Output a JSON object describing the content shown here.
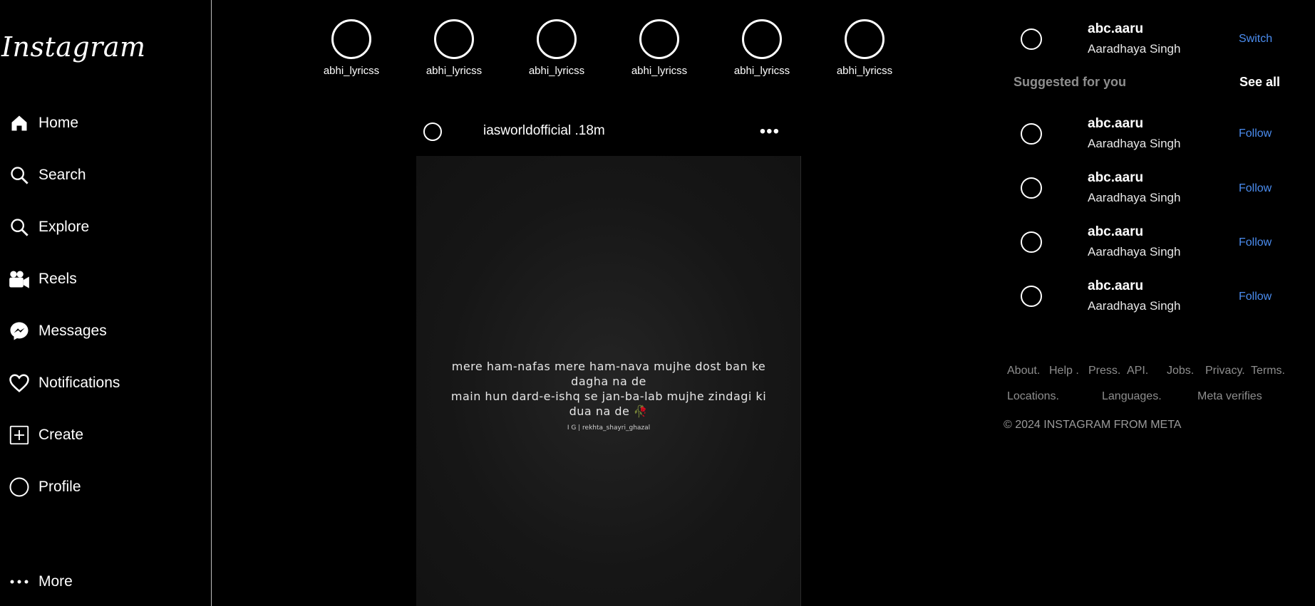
{
  "brand": "Instagram",
  "nav": [
    {
      "label": "Home",
      "icon": "home-icon"
    },
    {
      "label": "Search",
      "icon": "search-icon"
    },
    {
      "label": "Explore",
      "icon": "explore-icon"
    },
    {
      "label": "Reels",
      "icon": "reels-icon"
    },
    {
      "label": "Messages",
      "icon": "messenger-icon"
    },
    {
      "label": "Notifications",
      "icon": "heart-icon"
    },
    {
      "label": "Create",
      "icon": "plus-square-icon"
    },
    {
      "label": "Profile",
      "icon": "profile-avatar-icon"
    },
    {
      "label": "More",
      "icon": "more-dots-icon"
    }
  ],
  "stories": [
    {
      "username": "abhi_lyricss"
    },
    {
      "username": "abhi_lyricss"
    },
    {
      "username": "abhi_lyricss"
    },
    {
      "username": "abhi_lyricss"
    },
    {
      "username": "abhi_lyricss"
    },
    {
      "username": "abhi_lyricss"
    }
  ],
  "post": {
    "header": "iasworldofficial .18m",
    "more_icon": "•••",
    "lines": [
      "mere ham-nafas mere ham-nava mujhe dost ban ke dagha na de",
      "main hun dard-e-ishq se jan-ba-lab mujhe zindagi ki dua na de 🥀"
    ],
    "credit": "I G | rekhta_shayri_ghazal"
  },
  "account": {
    "username": "abc.aaru",
    "name": "Aaradhaya Singh",
    "action": "Switch"
  },
  "suggested": {
    "label": "Suggested for you",
    "see_all": "See all",
    "items": [
      {
        "username": "abc.aaru",
        "name": "Aaradhaya Singh",
        "action": "Follow"
      },
      {
        "username": "abc.aaru",
        "name": "Aaradhaya Singh",
        "action": "Follow"
      },
      {
        "username": "abc.aaru",
        "name": "Aaradhaya Singh",
        "action": "Follow"
      },
      {
        "username": "abc.aaru",
        "name": "Aaradhaya Singh",
        "action": "Follow"
      }
    ]
  },
  "footer": {
    "row1": [
      "About.",
      "Help .",
      "Press.",
      "API.",
      "Jobs.",
      "Privacy.",
      "Terms."
    ],
    "row2": [
      "Locations.",
      "Languages.",
      "Meta verifies"
    ],
    "copyright": "© 2024 INSTAGRAM FROM META"
  },
  "colors": {
    "background": "#000000",
    "link_blue": "#4b8df0",
    "muted": "#8e8e8e"
  }
}
